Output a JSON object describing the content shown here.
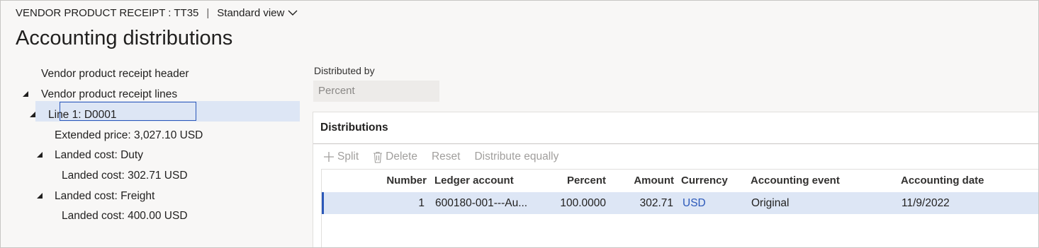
{
  "header": {
    "breadcrumb": "VENDOR PRODUCT RECEIPT : TT35",
    "separator": "|",
    "view_label": "Standard view",
    "page_title": "Accounting distributions"
  },
  "tree": {
    "items": [
      {
        "label": "Vendor product receipt header",
        "expanded": null
      },
      {
        "label": "Vendor product receipt lines",
        "expanded": true
      },
      {
        "label": "Line 1: D0001",
        "expanded": true
      },
      {
        "label": "Extended price: 3,027.10 USD",
        "expanded": null
      },
      {
        "label": "Landed cost: Duty",
        "expanded": true
      },
      {
        "label": "Landed cost: 302.71 USD",
        "expanded": null,
        "selected": true
      },
      {
        "label": "Landed cost: Freight",
        "expanded": true
      },
      {
        "label": "Landed cost: 400.00 USD",
        "expanded": null
      }
    ]
  },
  "distributed_by": {
    "label": "Distributed by",
    "value": "Percent"
  },
  "distributions": {
    "title": "Distributions",
    "toolbar": {
      "split": "Split",
      "delete": "Delete",
      "reset": "Reset",
      "distribute_equally": "Distribute equally"
    },
    "columns": {
      "number": "Number",
      "ledger_account": "Ledger account",
      "percent": "Percent",
      "amount": "Amount",
      "currency": "Currency",
      "accounting_event": "Accounting event",
      "accounting_date": "Accounting date"
    },
    "rows": [
      {
        "number": "1",
        "ledger_account": "600180-001---Au...",
        "percent": "100.0000",
        "amount": "302.71",
        "currency": "USD",
        "accounting_event": "Original",
        "accounting_date": "11/9/2022"
      }
    ]
  },
  "colors": {
    "accent": "#2b58b9",
    "selection": "#dde6f5",
    "disabled_text": "#a19f9d"
  }
}
